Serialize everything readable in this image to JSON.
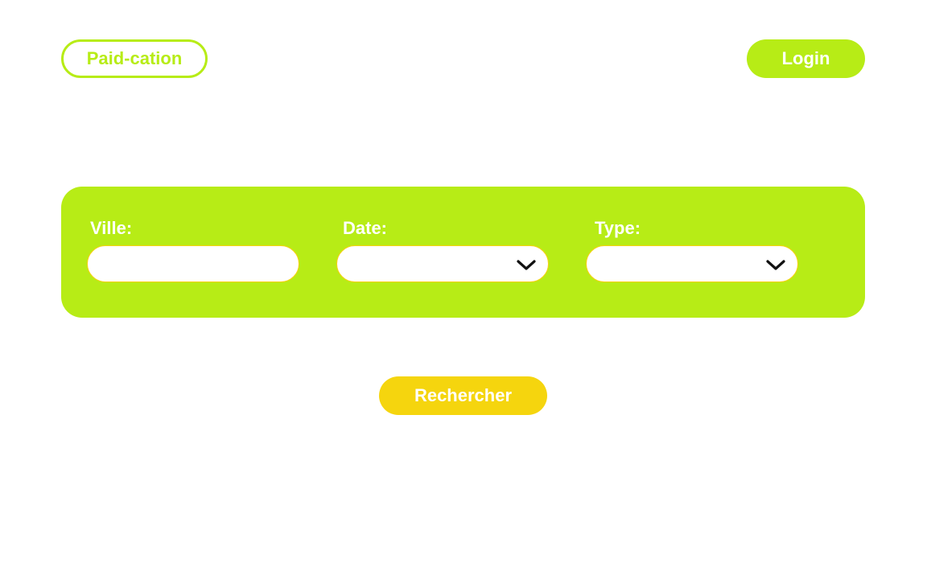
{
  "header": {
    "logo_label": "Paid-cation",
    "login_label": "Login"
  },
  "search": {
    "city": {
      "label": "Ville:",
      "value": "",
      "placeholder": ""
    },
    "date": {
      "label": "Date:",
      "selected": "",
      "icon": "chevron-down-icon"
    },
    "type": {
      "label": "Type:",
      "selected": "",
      "icon": "chevron-down-icon"
    },
    "submit_label": "Rechercher"
  },
  "colors": {
    "brand_green": "#b7ec16",
    "accent_yellow": "#f5d50e",
    "field_border": "#f5d20f",
    "background": "#ffffff"
  }
}
